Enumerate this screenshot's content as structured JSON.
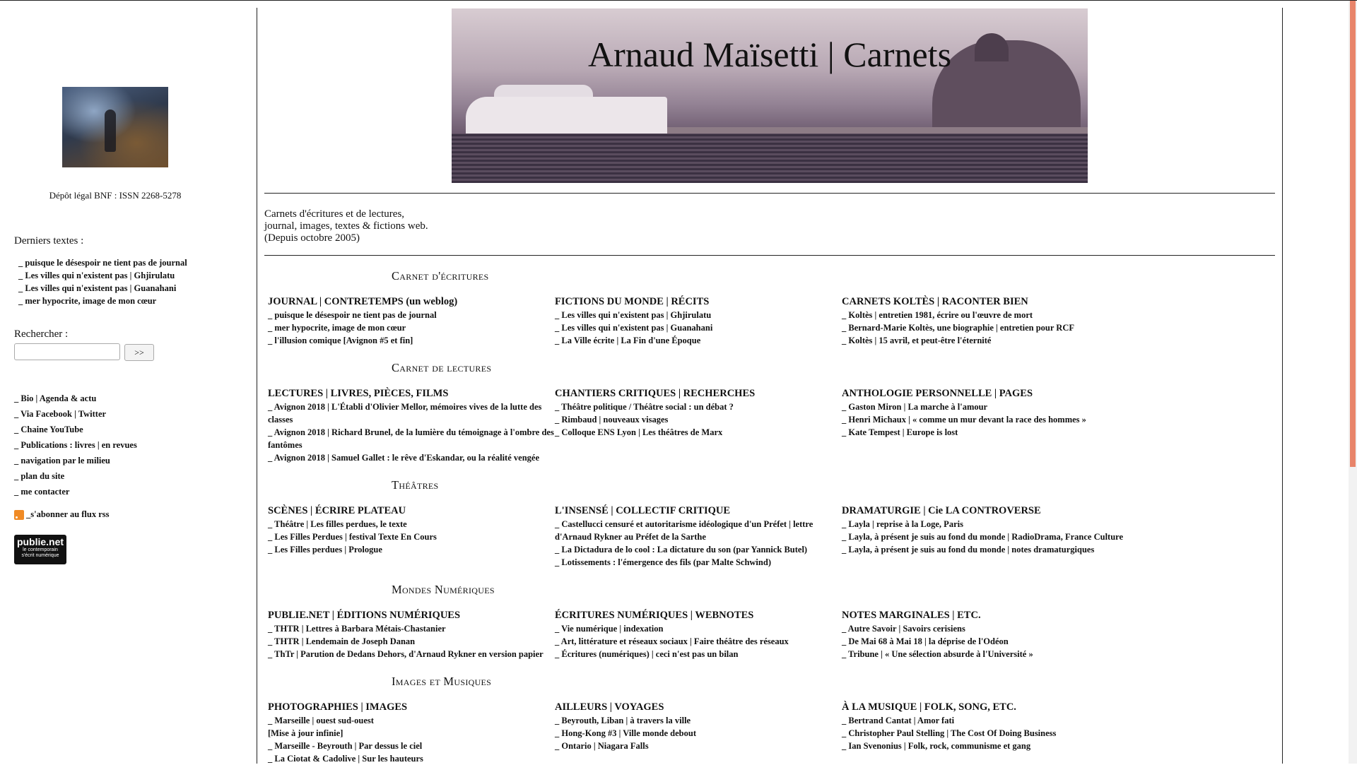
{
  "sidebar": {
    "legal": "Dépôt légal BNF : ISSN 2268-5278",
    "latest_heading": "Derniers textes :",
    "latest": [
      "_ puisque le désespoir ne tient pas de journal",
      "_ Les villes qui n'existent pas | Ghjirulatu",
      "_ Les villes qui n'existent pas | Guanahani",
      "_ mer hypocrite, image de mon cœur"
    ],
    "search_heading": "Rechercher :",
    "search_value": "",
    "search_button": ">>",
    "links": [
      "_ Bio | Agenda & actu",
      "_ Via Facebook | Twitter",
      "_ Chaine YouTube",
      "_ Publications : livres | en revues",
      "_ navigation par le milieu",
      "_ plan du site",
      "_ me contacter"
    ],
    "rss": "_s'abonner au flux rss",
    "logo": {
      "title": "publie.net",
      "line1": "le contemporain",
      "line2": "s'écrit numérique"
    }
  },
  "banner": {
    "title": "Arnaud Maïsetti | Carnets"
  },
  "intro": {
    "line1": "Carnets d'écritures et de lectures,",
    "line2": "journal, images, textes & fictions web.",
    "line3": "(Depuis octobre 2005)"
  },
  "sections": [
    {
      "heading": "Carnet d'écritures",
      "blocks": [
        {
          "title": "JOURNAL | CONTRETEMPS (un weblog)",
          "items": [
            "_ puisque le désespoir ne tient pas de journal",
            "_ mer hypocrite, image de mon cœur",
            "_ l'illusion comique [Avignon #5 et fin]"
          ]
        },
        {
          "title": "FICTIONS DU MONDE | RÉCITS",
          "items": [
            "_ Les villes qui n'existent pas | Ghjirulatu",
            "_ Les villes qui n'existent pas | Guanahani",
            "_ La Ville écrite | La Fin d'une Époque"
          ]
        },
        {
          "title": "CARNETS KOLTÈS | RACONTER BIEN",
          "items": [
            "_ Koltès | entretien 1981, écrire ou l'œuvre de mort",
            "_ Bernard-Marie Koltès, une biographie | entretien pour RCF",
            "_ Koltès | 15 avril, et peut-être l'éternité"
          ]
        }
      ]
    },
    {
      "heading": "Carnet de lectures",
      "blocks": [
        {
          "title": "LECTURES | LIVRES, PIÈCES, FILMS",
          "items": [
            "_ Avignon 2018 | L'Établi d'Olivier Mellor, mémoires vives de la lutte des classes",
            "_ Avignon 2018 | Richard Brunel, de la lumière du témoignage à l'ombre des fantômes",
            "_ Avignon 2018 | Samuel Gallet : le rêve d'Eskandar, ou la réalité vengée"
          ]
        },
        {
          "title": "CHANTIERS CRITIQUES | RECHERCHES",
          "items": [
            "_ Théâtre politique / Théâtre social : un débat ?",
            "_ Rimbaud | nouveaux visages",
            "_ Colloque ENS Lyon | Les théâtres de Marx"
          ]
        },
        {
          "title": "ANTHOLOGIE PERSONNELLE | PAGES",
          "items": [
            "_ Gaston Miron | La marche à l'amour",
            "_ Henri Michaux | « comme un mur devant la race des hommes »",
            "_ Kate Tempest | Europe is lost"
          ]
        }
      ]
    },
    {
      "heading": "Théâtres",
      "blocks": [
        {
          "title": "SCÈNES | ÉCRIRE PLATEAU",
          "items": [
            "_ Théâtre | Les filles perdues, le texte",
            "_ Les Filles Perdues | festival Texte En Cours",
            "_ Les Filles perdues | Prologue"
          ]
        },
        {
          "title": "L'INSENSÉ | COLLECTIF CRITIQUE",
          "items": [
            "_ Castellucci censuré et autoritarisme idéologique d'un Préfet | lettre d'Arnaud Rykner au Préfet de la Sarthe",
            "_ La Dictadura de lo cool : La dictature du son (par Yannick Butel)",
            "_ Lotissements : l'émergence des fils (par Malte Schwind)"
          ]
        },
        {
          "title": "DRAMATURGIE | Cie LA CONTROVERSE",
          "items": [
            "_ Layla | reprise à la Loge, Paris",
            "_ Layla, à présent je suis au fond du monde | RadioDrama, France Culture",
            "_ Layla, à présent je suis au fond du monde | notes dramaturgiques"
          ]
        }
      ]
    },
    {
      "heading": "Mondes Numériques",
      "blocks": [
        {
          "title": "PUBLIE.NET | ÉDITIONS NUMÉRIQUES",
          "items": [
            "_ THTR | Lettres à Barbara Métais-Chastanier",
            "_ THTR | Lendemain de Joseph Danan",
            "_ ThTr | Parution de Dedans Dehors, d'Arnaud Rykner en version papier"
          ]
        },
        {
          "title": "ÉCRITURES NUMÉRIQUES | WEBNOTES",
          "items": [
            "_ Vie numérique | indexation",
            "_ Art, littérature et réseaux sociaux | Faire théâtre des réseaux",
            "_ Écritures (numériques) | ceci n'est pas un bilan"
          ]
        },
        {
          "title": "NOTES MARGINALES | ETC.",
          "items": [
            "_ Autre Savoir | Savoirs cerisiens",
            "_ De Mai 68 à Mai 18 | la déprise de l'Odéon",
            "_ Tribune | « Une sélection absurde à l'Université »"
          ]
        }
      ]
    },
    {
      "heading": "Images et Musiques",
      "blocks": [
        {
          "title": "PHOTOGRAPHIES | IMAGES",
          "items": [
            "_ Marseille | ouest sud-ouest",
            "[Mise à jour infinie]",
            "_ Marseille - Beyrouth | Par dessus le ciel",
            "_ La Ciotat & Cadolive | Sur les hauteurs"
          ]
        },
        {
          "title": "AILLEURS | VOYAGES",
          "items": [
            "_ Beyrouth, Liban | à travers la ville",
            "_ Hong-Kong #3 | Ville monde debout",
            "_ Ontario | Niagara Falls"
          ]
        },
        {
          "title": "À LA MUSIQUE | FOLK, SONG, ETC.",
          "items": [
            "_ Bertrand Cantat | Amor fati",
            "_ Christopher Paul Stelling | The Cost Of Doing Business",
            "_ Ian Svenonius | Folk, rock, communisme et gang"
          ]
        }
      ]
    }
  ]
}
